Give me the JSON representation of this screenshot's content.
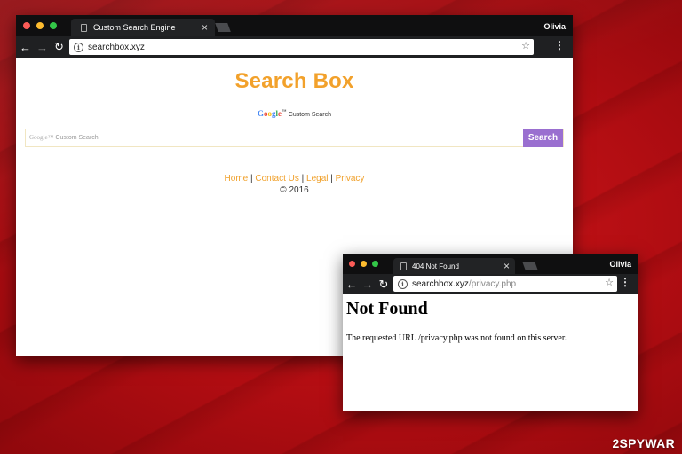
{
  "colors": {
    "close": "#fc5c57",
    "minimize": "#fdbc2f",
    "zoom": "#33c748",
    "brand_orange": "#f2a12b",
    "search_button": "#9a6fd0"
  },
  "window1": {
    "tab_title": "Custom Search Engine",
    "user": "Olivia",
    "url_host": "searchbox.xyz",
    "url_path": "",
    "page": {
      "title": "Search Box",
      "google_logo": "Google",
      "google_tm": "™",
      "custom_search": "Custom Search",
      "search_placeholder_logo": "Google™",
      "search_placeholder": "Custom Search",
      "search_button": "Search",
      "links": [
        "Home",
        "Contact Us",
        "Legal",
        "Privacy"
      ],
      "separator": " | ",
      "copyright": "© 2016"
    }
  },
  "window2": {
    "tab_title": "404 Not Found",
    "user": "Olivia",
    "url_host": "searchbox.xyz",
    "url_path": "/privacy.php",
    "page": {
      "heading": "Not Found",
      "message": "The requested URL /privacy.php was not found on this server."
    }
  },
  "icons": {
    "back": "←",
    "forward": "→",
    "reload": "↻",
    "info": "i",
    "star": "☆",
    "menu": "⋮",
    "close": "×"
  },
  "watermark": "2SPYWAR"
}
